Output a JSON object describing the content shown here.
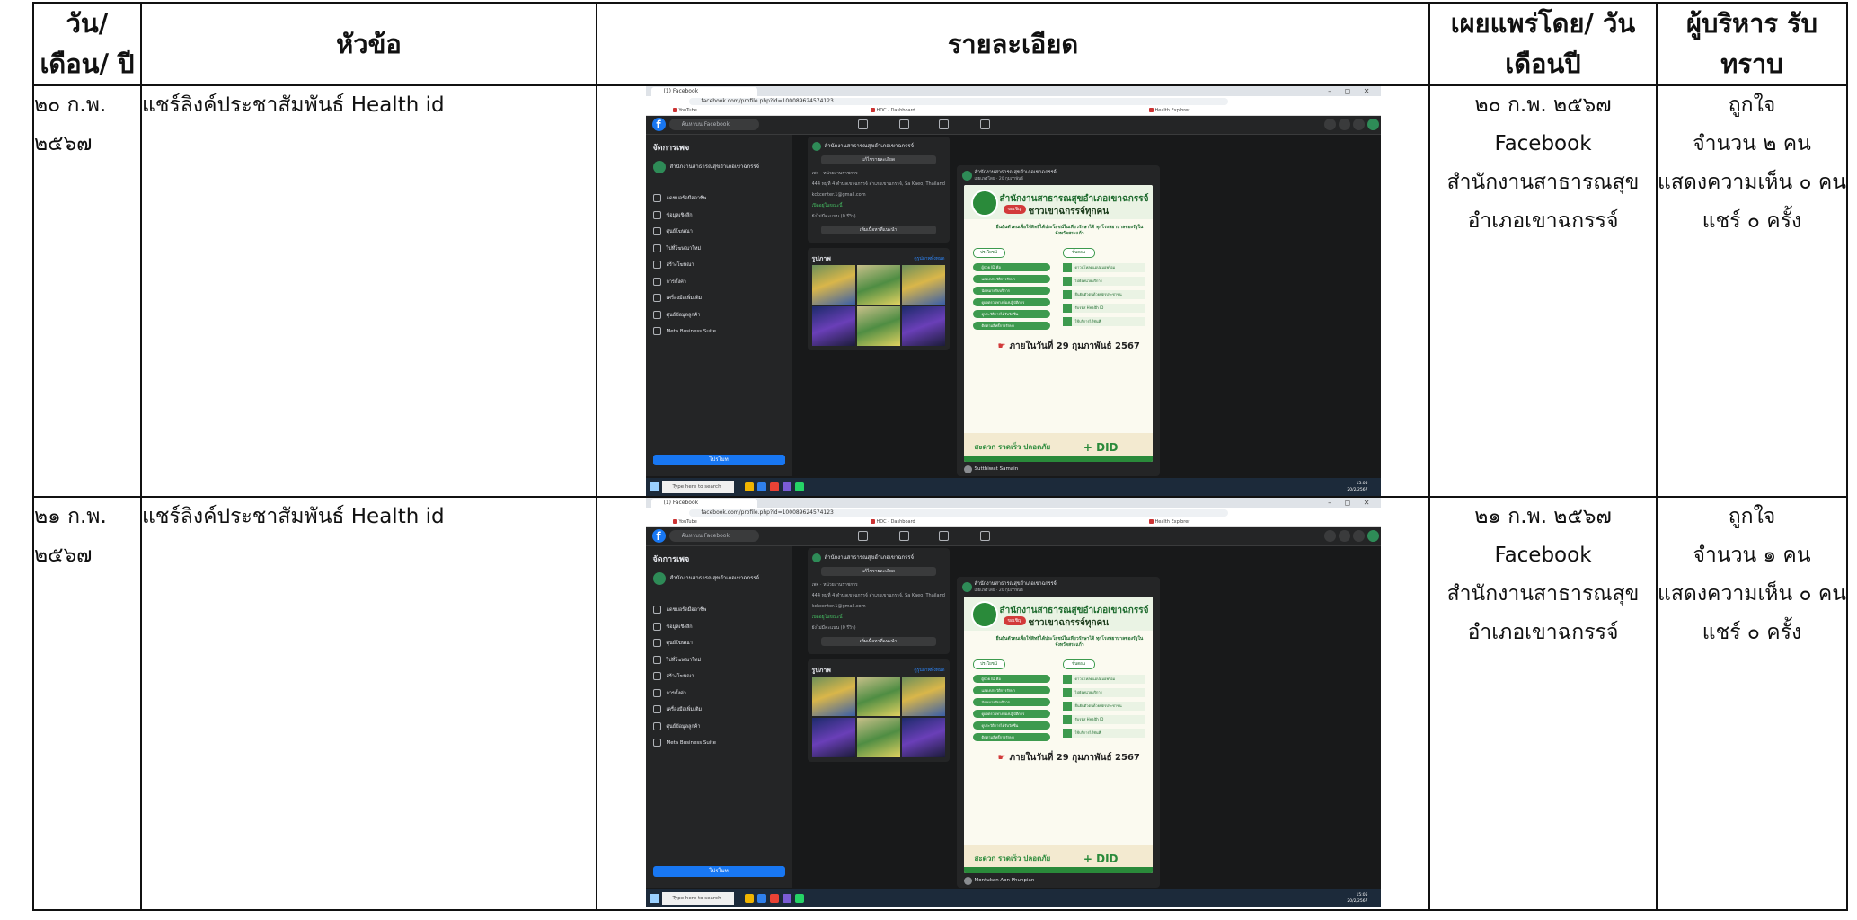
{
  "headers": {
    "date": "วัน/เดือน/ ปี",
    "topic": "หัวข้อ",
    "detail": "รายละเอียด",
    "published": "เผยแพร่โดย/ วันเดือนปี",
    "acknowledged": "ผู้บริหาร รับทราบ"
  },
  "rows": [
    {
      "date": "๒๐ ก.พ. ๒๕๖๗",
      "topic": "แชร์ลิงค์ประชาสัมพันธ์ Health id",
      "published": {
        "date": "๒๐ ก.พ. ๒๕๖๗",
        "channel": "Facebook",
        "org": "สำนักงานสาธารณสุขอำเภอเขาฉกรรจ์"
      },
      "ack": {
        "likes_label": "ถูกใจ",
        "likes": "จำนวน ๒ คน",
        "comments": "แสดงความเห็น ๐ คน",
        "shares": "แชร์ ๐ ครั้ง"
      },
      "commenter": "Sutthiwat Samain"
    },
    {
      "date": "๒๑ ก.พ. ๒๕๖๗",
      "topic": "แชร์ลิงค์ประชาสัมพันธ์ Health id",
      "published": {
        "date": "๒๑ ก.พ. ๒๕๖๗",
        "channel": "Facebook",
        "org": "สำนักงานสาธารณสุขอำเภอเขาฉกรรจ์"
      },
      "ack": {
        "likes_label": "ถูกใจ",
        "likes": "จำนวน ๑ คน",
        "comments": "แสดงความเห็น ๐ คน",
        "shares": "แชร์ ๐ ครั้ง"
      },
      "commenter": "Montukan Aon Phunpian"
    }
  ],
  "screenshot": {
    "tab_title": "(1) Facebook",
    "url": "facebook.com/profile.php?id=100089624574123",
    "window_controls": "–  ◻  ✕",
    "bookmarks": [
      "YouTube",
      "HDC - Dashboard",
      "Health Explorer"
    ],
    "fb_logo": "f",
    "fb_search": "ค้นหาบน Facebook",
    "sidebar_title": "จัดการเพจ",
    "page_name": "สำนักงานสาธารณสุขอำเภอเขาฉกรรจ์",
    "sidebar_items": [
      "แดชบอร์ดมืออาชีพ",
      "ข้อมูลเชิงลึก",
      "ศูนย์โฆษณา",
      "ไปที่โฆษณาใหม่",
      "สร้างโฆษณา",
      "การตั้งค่า",
      "เครื่องมือเพิ่มเติม",
      "ศูนย์ข้อมูลลูกค้า",
      "Meta Business Suite"
    ],
    "promote_label": "โปรโมท",
    "edit_details": "แก้ไขรายละเอียด",
    "info_lines": [
      "เพจ · หน่วยงานราชการ",
      "444 หมู่ที่ 4 ตำบลเขาฉกรรจ์ อำเภอเขาฉกรรจ์, Sa Kaeo, Thailand",
      "kckcenter.1@gmail.com",
      "เปิดอยู่ในขณะนี้",
      "ยังไม่มีคะแนน (0 รีวิว)"
    ],
    "add_featured": "เพิ่มเนื้อหาที่แนะนำ",
    "photos_label": "รูปภาพ",
    "see_all_photos": "ดูรูปภาพทั้งหมด",
    "post_time": "เผยแพร่โดย · 20 กุมภาพันธ์",
    "poster": {
      "title": "สำนักงานสาธารณสุขอำเภอเขาฉกรรจ์",
      "invite": "ขอเชิญ",
      "subtitle": "ชาวเขาฉกรรจ์ทุกคน",
      "lead": "ยืนยันตัวตนเพื่อใช้สิทธิ์ได้ประโยชน์ในเทียวรักษาได้ ทุกโรงพยาบาลของรัฐในจังหวัดสระแก้ว",
      "benefit_head": "ประโยชน์",
      "steps_head": "ขั้นตอน",
      "benefits": [
        "ผู้ป่วย ID คือ",
        "แสดงประวัติการรักษา",
        "นัดหมายรับบริการ",
        "ดูผลตรวจทางห้องปฏิบัติการ",
        "ดูประวัติการได้รับวัคซีน",
        "ติดตามสิทธิ์การรักษา"
      ],
      "steps": [
        "ดาวน์โหลดแอปหมอพร้อม",
        "ไปยังหน่วยบริการ",
        "ยืนยันตัวตนด้วยบัตรประชาชน",
        "รับรหัส Health ID",
        "ใช้บริการได้ทันที"
      ],
      "deadline": "ภายในวันที่ 29 กุมภาพันธ์ 2567",
      "slogan": "สะดวก รวดเร็ว ปลอดภัย",
      "id_mark": "+ DID"
    },
    "taskbar_search": "Type here to search",
    "clock_time": "15:05",
    "clock_date": "20/2/2567"
  }
}
